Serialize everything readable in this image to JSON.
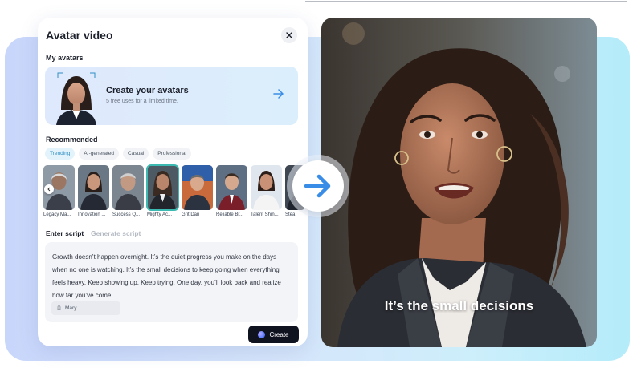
{
  "panel": {
    "title": "Avatar video",
    "my_avatars_label": "My avatars",
    "create_card": {
      "title": "Create your avatars",
      "subtitle": "5 free uses for a limited time."
    },
    "recommended_label": "Recommended",
    "filters": [
      "Trending",
      "AI-generated",
      "Casual",
      "Professional"
    ],
    "active_filter": "Trending",
    "avatars": [
      {
        "name": "Legacy Ma..."
      },
      {
        "name": "Innovation ..."
      },
      {
        "name": "Success Q..."
      },
      {
        "name": "Mighty Ac...",
        "selected": true
      },
      {
        "name": "Grit Dan"
      },
      {
        "name": "Reliable Br..."
      },
      {
        "name": "Talent Shin..."
      },
      {
        "name": "Stea"
      }
    ],
    "script_tabs": {
      "enter": "Enter script",
      "generate": "Generate script"
    },
    "script_text": "Growth doesn’t happen overnight. It’s the quiet progress you make on the days when no one is watching. It’s the small decisions to keep going when everything feels heavy. Keep showing up. Keep trying. One day, you’ll look back and realize how far you’ve come.",
    "voice": "Mary",
    "create_button": "Create"
  },
  "video": {
    "caption": "It’s the small decisions"
  },
  "colors": {
    "accent": "#3a8de6",
    "selected_outline": "#3cb9b0",
    "create_button_bg": "#0f1320"
  },
  "icons": {
    "close": "close-icon",
    "card_arrow": "arrow-right-icon",
    "scroll_left": "chevron-left-icon",
    "voice": "microphone-icon",
    "center_arrow": "arrow-right-icon"
  }
}
